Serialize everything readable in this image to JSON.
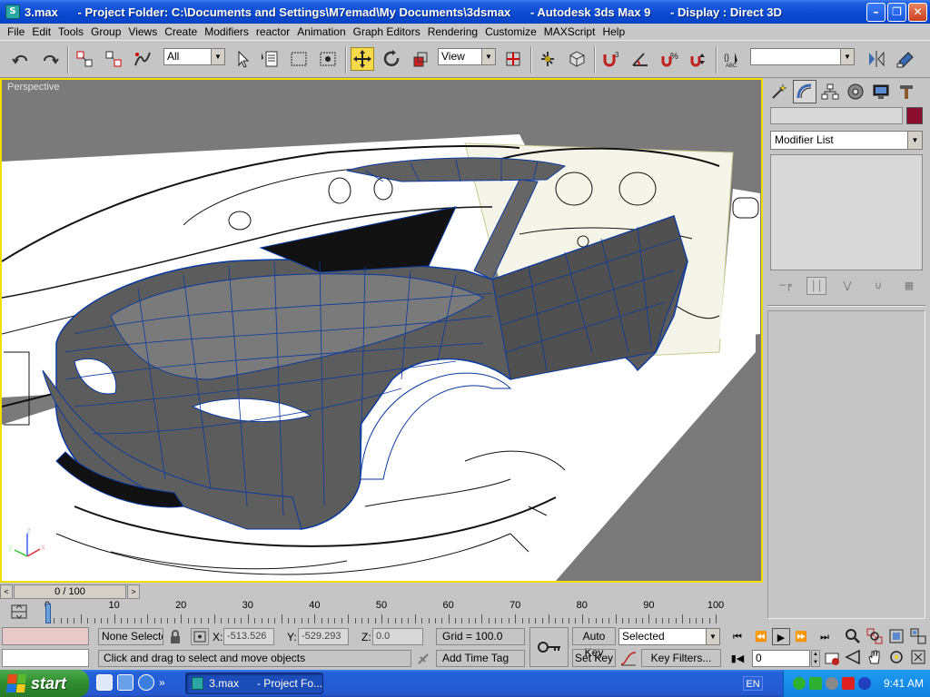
{
  "window": {
    "title": "3.max      - Project Folder: C:\\Documents and Settings\\M7emad\\My Documents\\3dsmax      - Autodesk 3ds Max 9      - Display : Direct 3D"
  },
  "menu": [
    "File",
    "Edit",
    "Tools",
    "Group",
    "Views",
    "Create",
    "Modifiers",
    "reactor",
    "Animation",
    "Graph Editors",
    "Rendering",
    "Customize",
    "MAXScript",
    "Help"
  ],
  "toolbar": {
    "selection_filter": "All",
    "reference_coord": "View",
    "named_selection": ""
  },
  "viewport": {
    "label": "Perspective",
    "axis_labels": {
      "x": "x",
      "y": "y",
      "z": "z"
    }
  },
  "command_panel": {
    "object_color": "#8a0f2e",
    "modifier_list": "Modifier List"
  },
  "time_slider": {
    "position": "0 / 100",
    "prev": "<",
    "next": ">"
  },
  "trackbar": {
    "labels": [
      "0",
      "10",
      "20",
      "30",
      "40",
      "50",
      "60",
      "70",
      "80",
      "90",
      "100"
    ]
  },
  "status": {
    "selection": "None Selecte",
    "x_label": "X:",
    "x_value": "-513.526",
    "y_label": "Y:",
    "y_value": "-529.293",
    "z_label": "Z:",
    "z_value": "0.0",
    "grid": "Grid = 100.0",
    "prompt": "Click and drag to select and move objects",
    "add_time_tag": "Add Time Tag",
    "auto_key": "Auto Key",
    "set_key": "Set Key",
    "key_mode": "Selected",
    "key_filters": "Key Filters...",
    "current_frame": "0"
  },
  "taskbar": {
    "start": "start",
    "task_item": "3.max      - Project Fo...",
    "language": "EN",
    "clock": "9:41 AM"
  }
}
